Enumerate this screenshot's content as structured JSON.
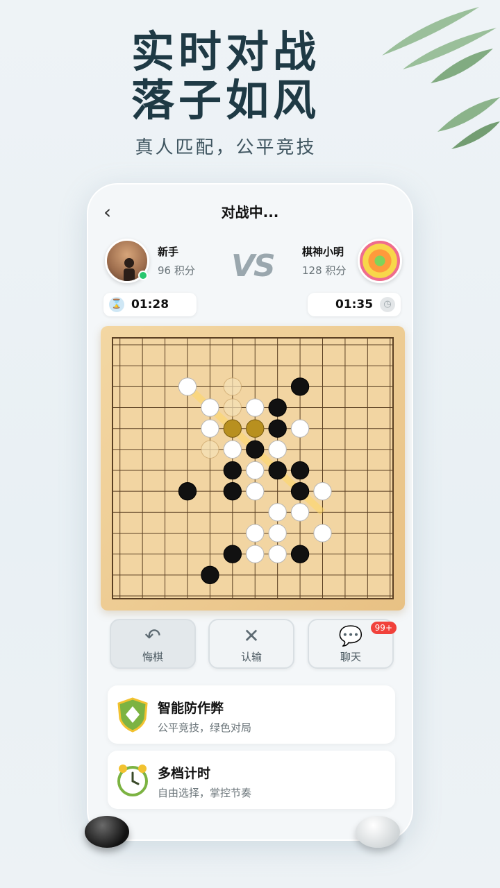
{
  "hero": {
    "line1": "实时对战",
    "line2": "落子如风",
    "subtitle": "真人匹配，公平竞技"
  },
  "topbar": {
    "back_icon": "chevron-left-icon",
    "title": "对战中..."
  },
  "players": {
    "left": {
      "name": "新手",
      "score": "96 积分",
      "timer": "01:28",
      "status": "online"
    },
    "right": {
      "name": "棋神小明",
      "score": "128 积分",
      "timer": "01:35"
    },
    "vs": "VS"
  },
  "board": {
    "size": 13,
    "white": [
      [
        3,
        2
      ],
      [
        4,
        3
      ],
      [
        6,
        3
      ],
      [
        4,
        4
      ],
      [
        8,
        4
      ],
      [
        5,
        5
      ],
      [
        7,
        5
      ],
      [
        6,
        6
      ],
      [
        6,
        7
      ],
      [
        9,
        7
      ],
      [
        7,
        8
      ],
      [
        8,
        8
      ],
      [
        6,
        9
      ],
      [
        6,
        10
      ],
      [
        7,
        10
      ],
      [
        7,
        9
      ],
      [
        9,
        9
      ]
    ],
    "black": [
      [
        8,
        2
      ],
      [
        7,
        3
      ],
      [
        7,
        4
      ],
      [
        6,
        5
      ],
      [
        5,
        6
      ],
      [
        7,
        6
      ],
      [
        8,
        6
      ],
      [
        3,
        7
      ],
      [
        5,
        7
      ],
      [
        8,
        7
      ],
      [
        5,
        10
      ],
      [
        8,
        10
      ],
      [
        4,
        11
      ]
    ],
    "gold": [
      [
        5,
        4
      ],
      [
        6,
        4
      ]
    ],
    "faint": [
      [
        5,
        2
      ],
      [
        5,
        3
      ],
      [
        4,
        5
      ]
    ]
  },
  "actions": {
    "undo": "悔棋",
    "resign": "认输",
    "chat": "聊天",
    "chat_badge": "99+"
  },
  "features": [
    {
      "title": "智能防作弊",
      "subtitle": "公平竞技，绿色对局",
      "icon": "shield-icon"
    },
    {
      "title": "多档计时",
      "subtitle": "自由选择，掌控节奏",
      "icon": "alarm-clock-icon"
    }
  ],
  "colors": {
    "accent": "#1f3a45",
    "badge": "#f1413b",
    "online": "#28c76f",
    "board": "#f2d5a2"
  }
}
